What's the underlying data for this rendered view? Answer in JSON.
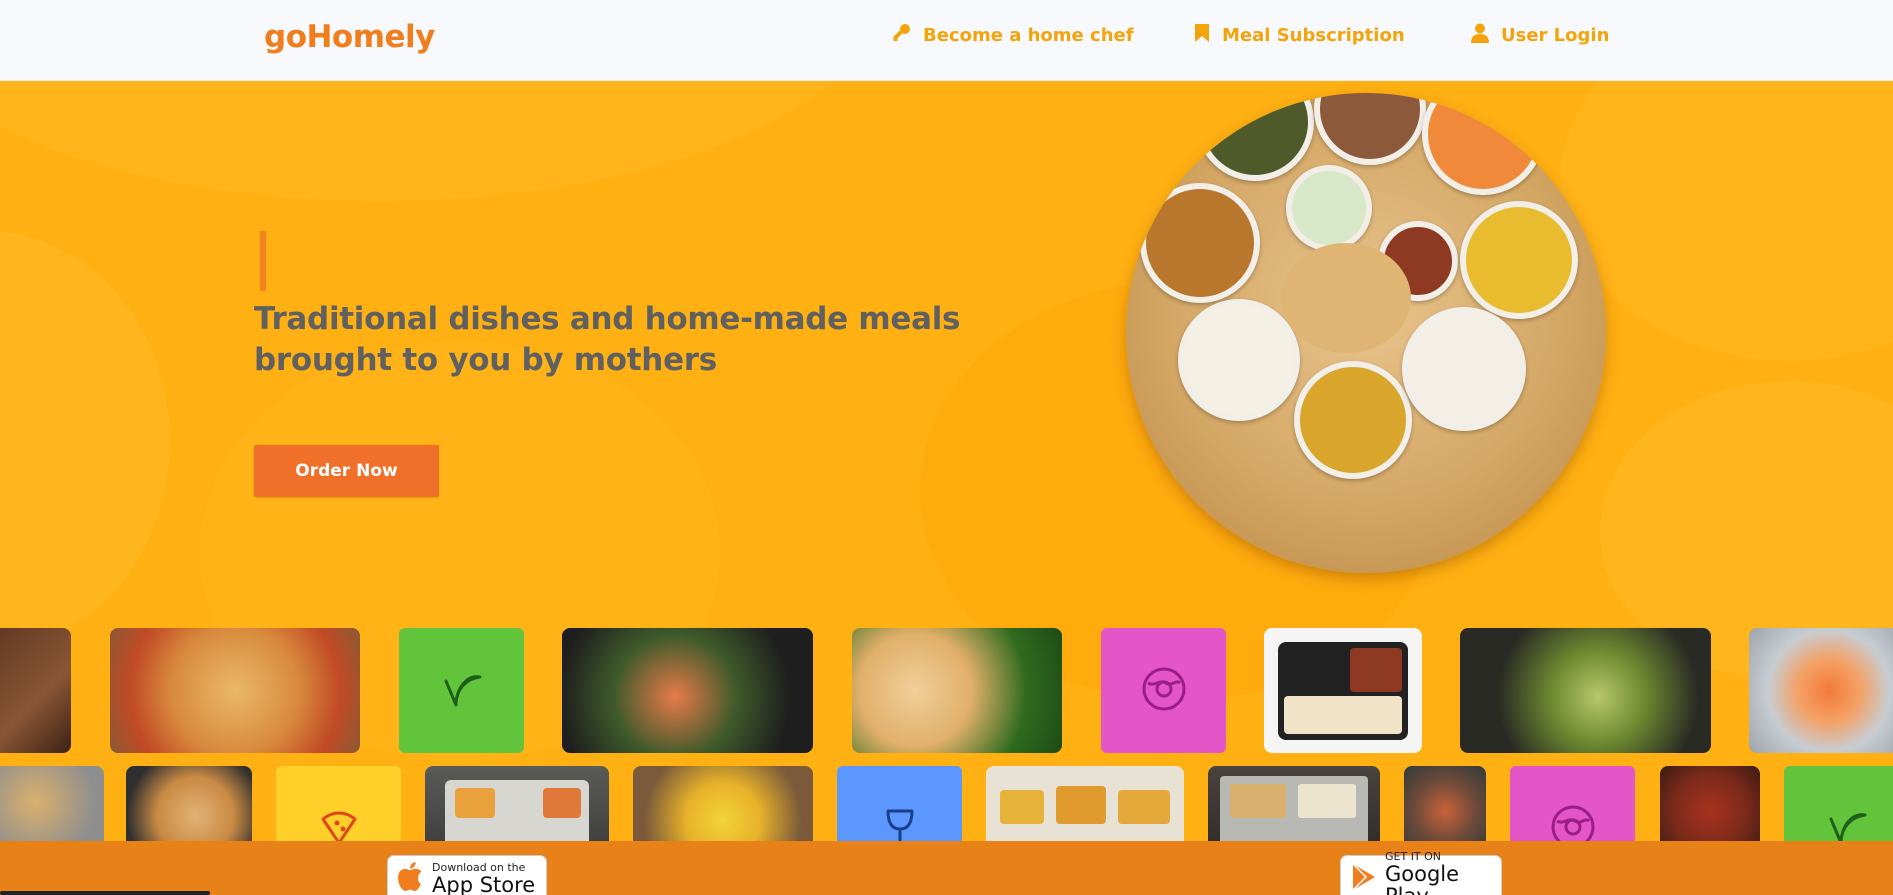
{
  "header": {
    "logo": "goHomely",
    "nav": [
      {
        "label": "Become a home chef",
        "icon": "key-icon"
      },
      {
        "label": "Meal Subscription",
        "icon": "bookmark-icon"
      },
      {
        "label": "User Login",
        "icon": "user-icon"
      }
    ]
  },
  "hero": {
    "headline": "Traditional dishes and home-made meals brought to you by mothers",
    "cta_label": "Order Now"
  },
  "footer": {
    "app_store": {
      "small": "Download on the",
      "big": "App Store"
    },
    "google_play": {
      "small": "GET IT ON",
      "big": "Google Play"
    }
  },
  "colors": {
    "brand_orange": "#F07E1F",
    "nav_gold": "#F5A30B",
    "hero_yellow": "#FFB012",
    "cta": "#F07029",
    "footer": "#E88117",
    "tile_green": "#62C43A",
    "tile_pink": "#E455C8",
    "tile_blue": "#5B97FF",
    "tile_yellow": "#FFD02A"
  },
  "tiles": [
    {
      "name": "fried-chicken-photo"
    },
    {
      "name": "pizza-photo"
    },
    {
      "name": "vegan-category",
      "icon": "leaf-icon"
    },
    {
      "name": "poke-bowl-photo"
    },
    {
      "name": "idli-photo"
    },
    {
      "name": "dessert-category",
      "icon": "donut-icon"
    },
    {
      "name": "meal-box-photo"
    },
    {
      "name": "curry-photo"
    },
    {
      "name": "sushi-photo"
    },
    {
      "name": "thali-plate-photo"
    },
    {
      "name": "puri-photo"
    },
    {
      "name": "pizza-category",
      "icon": "pizza-icon"
    },
    {
      "name": "tiffin-photo"
    },
    {
      "name": "pulao-photo"
    },
    {
      "name": "drinks-category",
      "icon": "wine-glass-icon"
    },
    {
      "name": "meal-tray-photo"
    },
    {
      "name": "steel-thali-photo"
    },
    {
      "name": "noodles-photo"
    },
    {
      "name": "dessert-category-2",
      "icon": "donut-icon"
    },
    {
      "name": "chili-chicken-photo"
    },
    {
      "name": "vegan-category-2",
      "icon": "leaf-icon"
    }
  ]
}
